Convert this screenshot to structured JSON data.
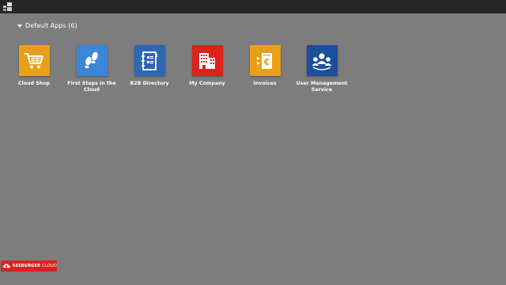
{
  "header": {
    "logo_icon": "grid-squares-icon"
  },
  "section": {
    "title": "Default Apps (6)"
  },
  "apps": [
    {
      "label": "Cloud Shop",
      "icon": "shopping-cart-icon",
      "color": "#e8a018"
    },
    {
      "label": "First Steps in the Cloud",
      "icon": "footprints-icon",
      "color": "#3a86d8"
    },
    {
      "label": "B2B Directory",
      "icon": "address-book-icon",
      "color": "#2e67b4"
    },
    {
      "label": "My Company",
      "icon": "office-building-icon",
      "color": "#dc2219"
    },
    {
      "label": "Invoices",
      "icon": "euro-invoice-icon",
      "color": "#e8a018"
    },
    {
      "label": "User Management Service",
      "icon": "user-group-icon",
      "color": "#1c4f9c"
    }
  ],
  "footer": {
    "brand_main": "SEEBURGER",
    "brand_cloud": "CLOUD",
    "brand_color": "#d7231f"
  }
}
